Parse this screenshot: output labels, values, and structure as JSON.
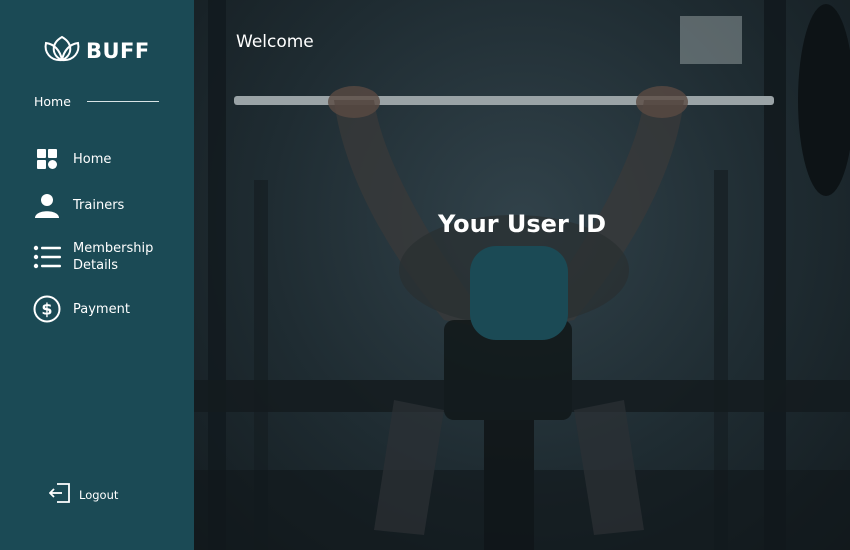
{
  "brand": {
    "name": "BUFF",
    "logo_icon": "lotus-icon"
  },
  "sidebar": {
    "breadcrumb": "Home",
    "items": [
      {
        "label": "Home",
        "icon": "dashboard-grid-icon"
      },
      {
        "label": "Trainers",
        "icon": "user-icon"
      },
      {
        "label": "Membership\nDetails",
        "icon": "list-icon"
      },
      {
        "label": "Payment",
        "icon": "dollar-circle-icon"
      }
    ],
    "logout_label": "Logout",
    "logout_icon": "logout-icon"
  },
  "main": {
    "welcome": "Welcome",
    "user_id_title": "Your User ID",
    "user_id_value": ""
  },
  "colors": {
    "sidebar_bg": "#1b4a55",
    "accent": "#1b4a55",
    "text": "#ffffff"
  }
}
